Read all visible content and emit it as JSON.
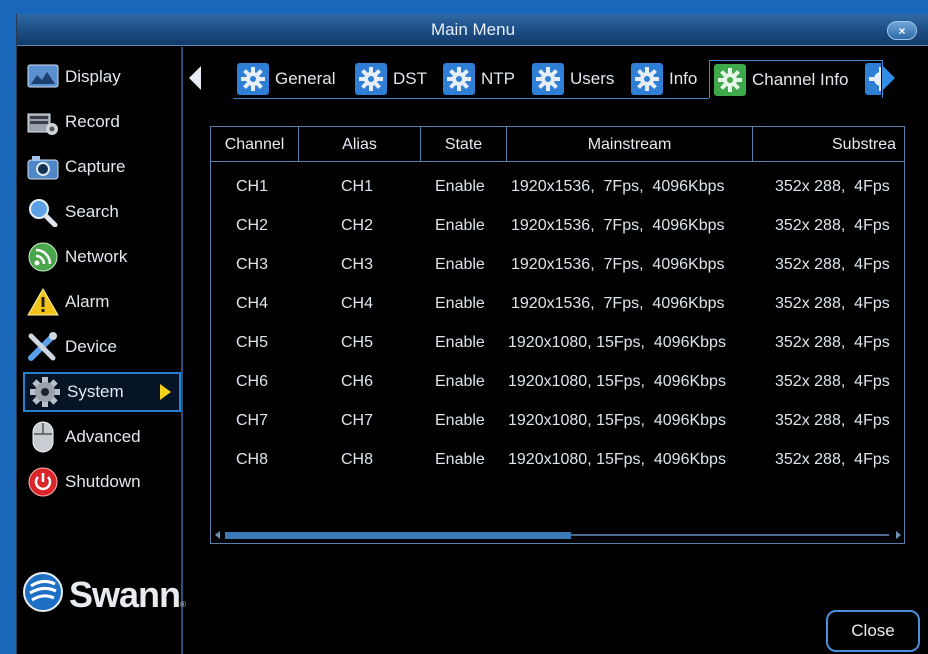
{
  "window": {
    "title": "Main Menu",
    "close_glyph": "×"
  },
  "sidebar": {
    "items": [
      {
        "label": "Display",
        "icon": "display-icon"
      },
      {
        "label": "Record",
        "icon": "record-icon"
      },
      {
        "label": "Capture",
        "icon": "camera-icon"
      },
      {
        "label": "Search",
        "icon": "search-icon"
      },
      {
        "label": "Network",
        "icon": "network-icon"
      },
      {
        "label": "Alarm",
        "icon": "alarm-icon"
      },
      {
        "label": "Device",
        "icon": "device-icon"
      },
      {
        "label": "System",
        "icon": "gear-icon",
        "active": true
      },
      {
        "label": "Advanced",
        "icon": "mouse-icon"
      },
      {
        "label": "Shutdown",
        "icon": "power-icon"
      }
    ]
  },
  "logo": {
    "text": "Swann",
    "mark": "®"
  },
  "tabs": [
    {
      "label": "General",
      "icon": "gear-icon"
    },
    {
      "label": "DST",
      "icon": "gear-icon"
    },
    {
      "label": "NTP",
      "icon": "gear-icon"
    },
    {
      "label": "Users",
      "icon": "gear-icon"
    },
    {
      "label": "Info",
      "icon": "gear-icon"
    },
    {
      "label": "Channel Info",
      "icon": "gear-icon",
      "active": true
    }
  ],
  "table": {
    "columns": [
      "Channel",
      "Alias",
      "State",
      "Mainstream",
      "Substrea"
    ],
    "rows": [
      [
        "CH1",
        "CH1",
        "Enable",
        "1920x1536,  7Fps,  4096Kbps",
        "352x 288,  4Fps"
      ],
      [
        "CH2",
        "CH2",
        "Enable",
        "1920x1536,  7Fps,  4096Kbps",
        "352x 288,  4Fps"
      ],
      [
        "CH3",
        "CH3",
        "Enable",
        "1920x1536,  7Fps,  4096Kbps",
        "352x 288,  4Fps"
      ],
      [
        "CH4",
        "CH4",
        "Enable",
        "1920x1536,  7Fps,  4096Kbps",
        "352x 288,  4Fps"
      ],
      [
        "CH5",
        "CH5",
        "Enable",
        "1920x1080, 15Fps,  4096Kbps",
        "352x 288,  4Fps"
      ],
      [
        "CH6",
        "CH6",
        "Enable",
        "1920x1080, 15Fps,  4096Kbps",
        "352x 288,  4Fps"
      ],
      [
        "CH7",
        "CH7",
        "Enable",
        "1920x1080, 15Fps,  4096Kbps",
        "352x 288,  4Fps"
      ],
      [
        "CH8",
        "CH8",
        "Enable",
        "1920x1080, 15Fps,  4096Kbps",
        "352x 288,  4Fps"
      ]
    ]
  },
  "footer": {
    "close_label": "Close"
  },
  "colors": {
    "accent": "#2b7fd0",
    "background": "#000000",
    "frame": "#1a66b8",
    "active_arrow": "#f3d21a"
  }
}
